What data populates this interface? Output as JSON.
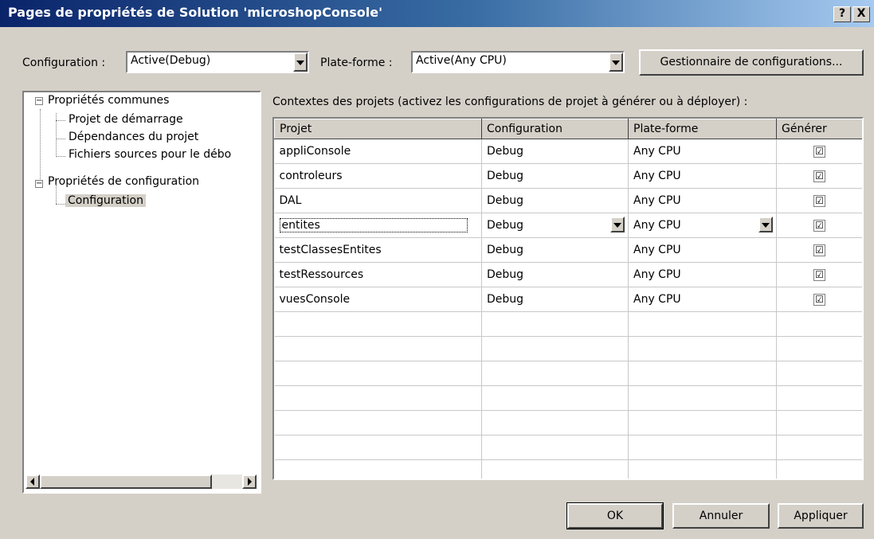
{
  "window": {
    "title": "Pages de propriétés de Solution 'microshopConsole'",
    "help_glyph": "?",
    "close_glyph": "X"
  },
  "toolbar": {
    "configuration_label": "Configuration :",
    "configuration_value": "Active(Debug)",
    "platform_label": "Plate-forme :",
    "platform_value": "Active(Any CPU)",
    "config_manager_button": "Gestionnaire de configurations..."
  },
  "tree": {
    "common_props": "Propriétés communes",
    "startup_project": "Projet de démarrage",
    "project_dependencies": "Dépendances du projet",
    "debug_sources": "Fichiers sources pour le débo",
    "config_props": "Propriétés de configuration",
    "configuration": "Configuration",
    "expander_glyph": "−"
  },
  "main": {
    "heading": "Contextes des projets (activez les configurations de projet à générer ou à déployer) :",
    "columns": [
      "Projet",
      "Configuration",
      "Plate-forme",
      "Générer"
    ],
    "rows": [
      {
        "project": "appliConsole",
        "configuration": "Debug",
        "platform": "Any CPU",
        "build": "☑"
      },
      {
        "project": "controleurs",
        "configuration": "Debug",
        "platform": "Any CPU",
        "build": "☑"
      },
      {
        "project": "DAL",
        "configuration": "Debug",
        "platform": "Any CPU",
        "build": "☑"
      },
      {
        "project": "entites",
        "configuration": "Debug",
        "platform": "Any CPU",
        "build": "☑"
      },
      {
        "project": "testClassesEntites",
        "configuration": "Debug",
        "platform": "Any CPU",
        "build": "☑"
      },
      {
        "project": "testRessources",
        "configuration": "Debug",
        "platform": "Any CPU",
        "build": "☑"
      },
      {
        "project": "vuesConsole",
        "configuration": "Debug",
        "platform": "Any CPU",
        "build": "☑"
      }
    ]
  },
  "footer": {
    "ok": "OK",
    "cancel": "Annuler",
    "apply": "Appliquer"
  }
}
